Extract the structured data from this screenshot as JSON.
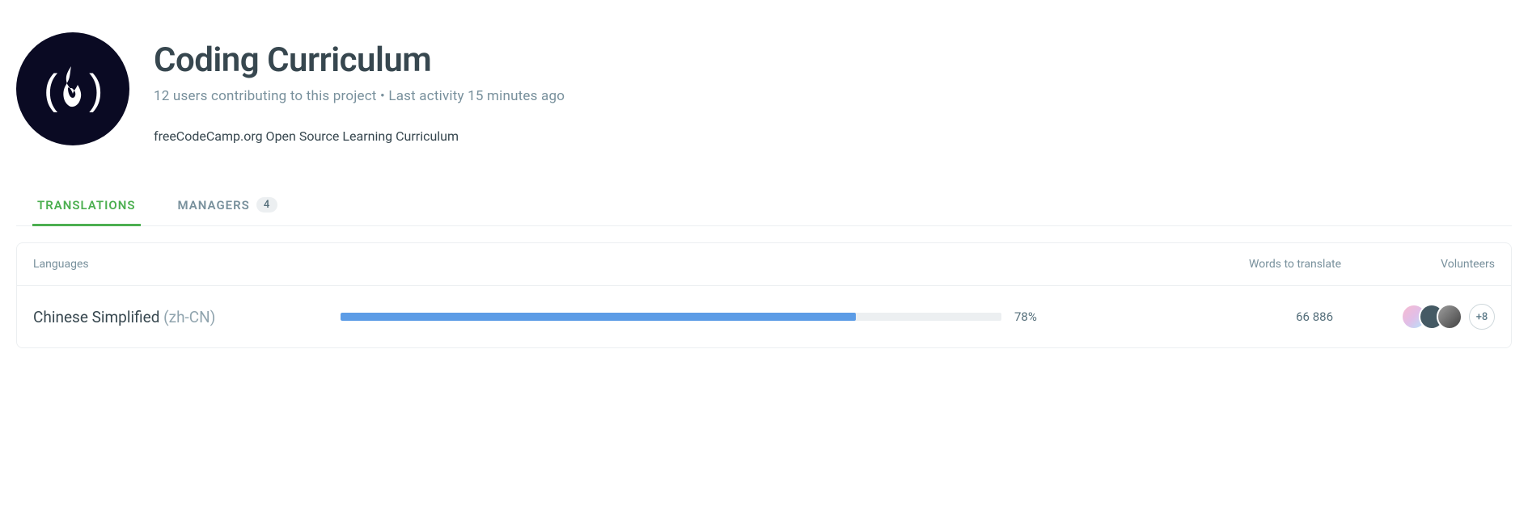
{
  "header": {
    "title": "Coding Curriculum",
    "meta": "12 users contributing to this project • Last activity 15 minutes ago",
    "description": "freeCodeCamp.org Open Source Learning Curriculum"
  },
  "tabs": {
    "translations": {
      "label": "TRANSLATIONS",
      "active": true
    },
    "managers": {
      "label": "MANAGERS",
      "count": "4"
    }
  },
  "table": {
    "columns": {
      "languages": "Languages",
      "words": "Words to translate",
      "volunteers": "Volunteers"
    },
    "rows": [
      {
        "language": "Chinese Simplified",
        "code": "(zh-CN)",
        "percent": 78,
        "percent_label": "78%",
        "words": "66 886",
        "more_volunteers": "+8"
      }
    ]
  }
}
